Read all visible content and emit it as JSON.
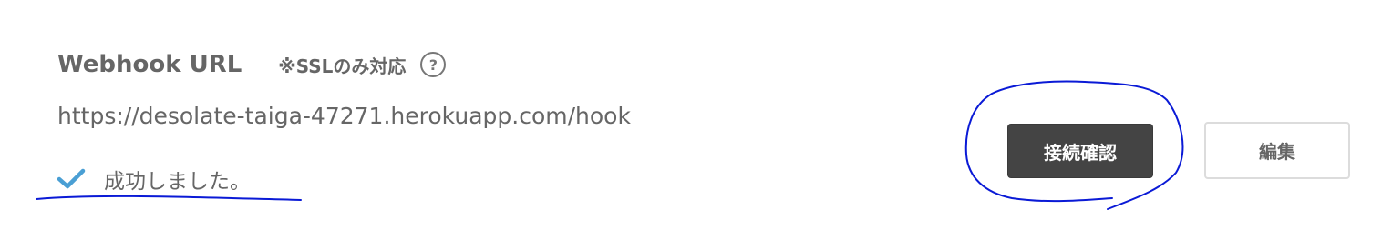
{
  "webhook": {
    "title": "Webhook URL",
    "note": "※SSLのみ対応",
    "help_icon": "question-circle-icon",
    "help_glyph": "?",
    "url": "https://desolate-taiga-47271.herokuapp.com/hook",
    "status_icon": "checkmark-icon",
    "status_text": "成功しました。"
  },
  "buttons": {
    "confirm_label": "接続確認",
    "edit_label": "編集"
  },
  "colors": {
    "text": "#666666",
    "check": "#4a9fd4",
    "confirm_button_bg": "#444444",
    "annotation": "#0a1ad6"
  }
}
